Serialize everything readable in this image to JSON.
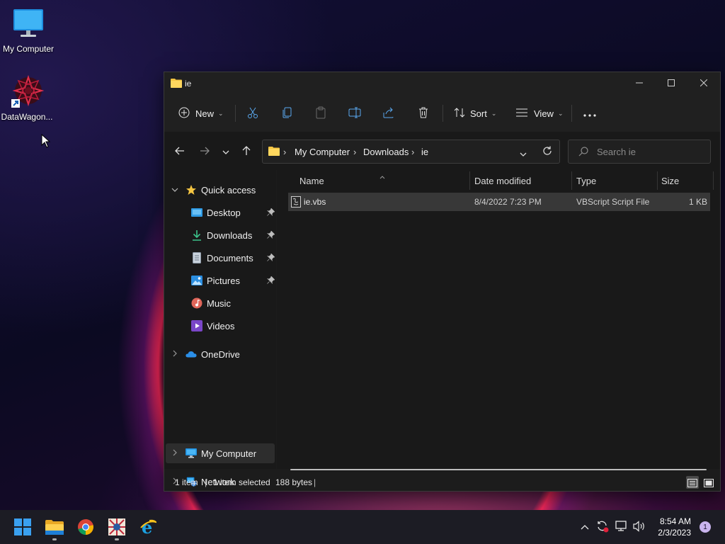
{
  "desktop": {
    "icons": [
      {
        "label": "My Computer",
        "icon": "monitor-icon"
      },
      {
        "label": "DataWagon...",
        "icon": "datawagon-icon"
      }
    ]
  },
  "window": {
    "title": "ie",
    "toolbar": {
      "new_label": "New",
      "sort_label": "Sort",
      "view_label": "View"
    },
    "address": {
      "crumbs": [
        "My Computer",
        "Downloads",
        "ie"
      ]
    },
    "search": {
      "placeholder": "Search ie"
    },
    "nav": {
      "quick_access": "Quick access",
      "items": [
        {
          "label": "Desktop",
          "pinned": true
        },
        {
          "label": "Downloads",
          "pinned": true
        },
        {
          "label": "Documents",
          "pinned": true
        },
        {
          "label": "Pictures",
          "pinned": true
        },
        {
          "label": "Music",
          "pinned": false
        },
        {
          "label": "Videos",
          "pinned": false
        }
      ],
      "onedrive": "OneDrive",
      "my_computer": "My Computer",
      "network": "Network"
    },
    "columns": [
      "Name",
      "Date modified",
      "Type",
      "Size"
    ],
    "files": [
      {
        "name": "ie.vbs",
        "date_modified": "8/4/2022 7:23 PM",
        "type": "VBScript Script File",
        "size": "1 KB"
      }
    ],
    "status": {
      "count": "1 item",
      "selected": "1 item selected",
      "bytes": "188 bytes"
    }
  },
  "taskbar": {
    "apps": [
      "start-icon",
      "file-explorer-icon",
      "chrome-icon",
      "datawagon-icon",
      "internet-explorer-icon"
    ],
    "clock": {
      "time": "8:54 AM",
      "date": "2/3/2023"
    },
    "notification_count": "1"
  },
  "colors": {
    "window_bg": "#1c1c1c",
    "accent": "#0a84ff",
    "selection": "#383838"
  }
}
